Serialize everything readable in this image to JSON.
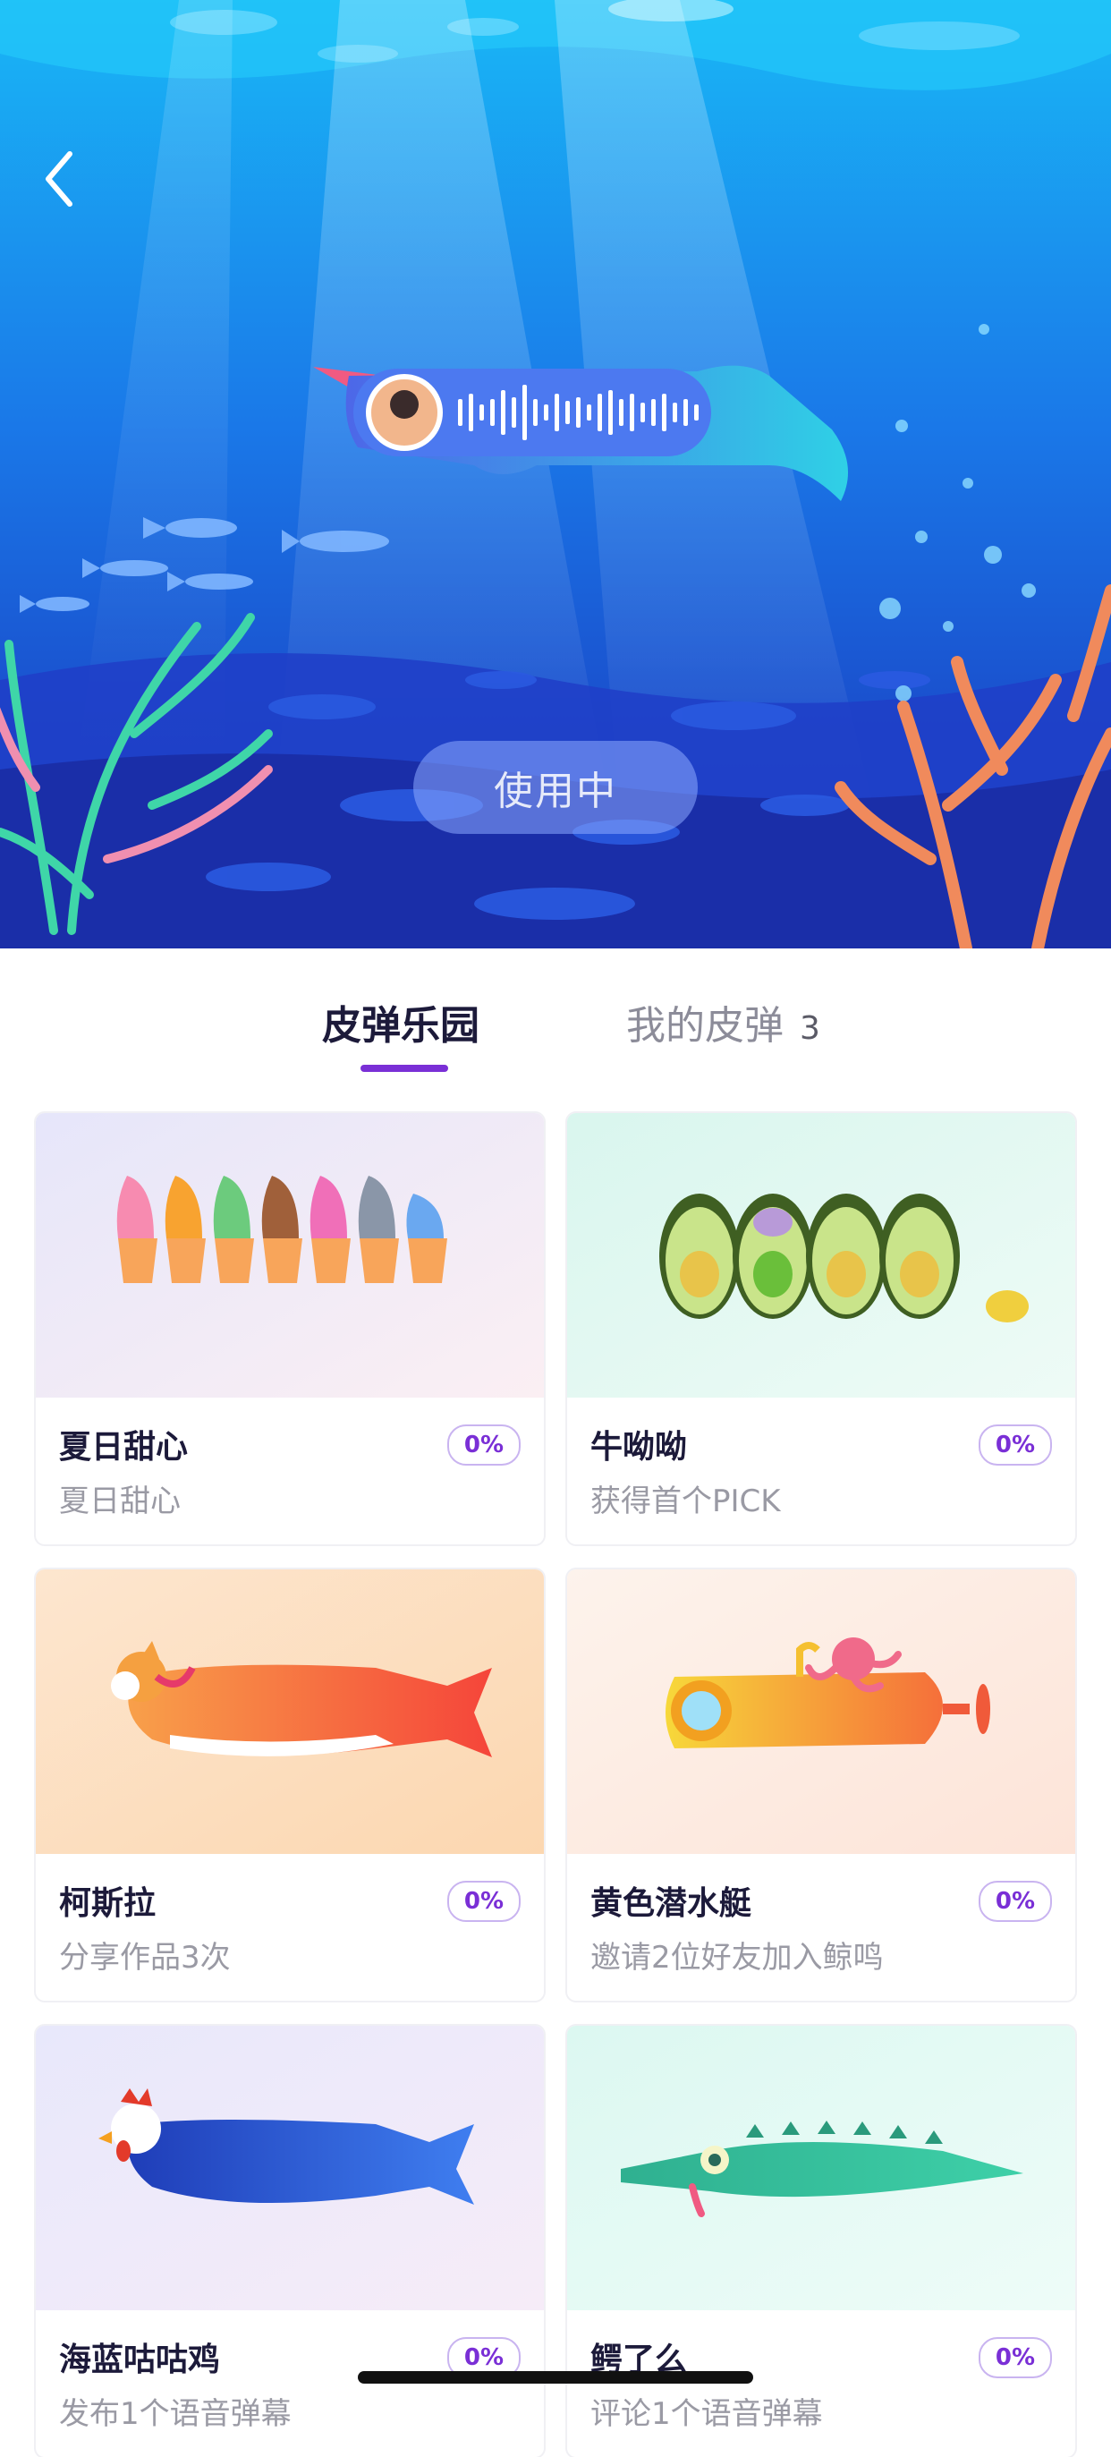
{
  "hero": {
    "use_button_label": "使用中"
  },
  "tabs": [
    {
      "label": "皮弹乐园",
      "active": true
    },
    {
      "label": "我的皮弹",
      "count": "3",
      "active": false
    }
  ],
  "cards": [
    {
      "name": "夏日甜心",
      "desc": "夏日甜心",
      "progress": "0%",
      "theme": "ice-cream"
    },
    {
      "name": "牛呦呦",
      "desc": "获得首个PICK",
      "progress": "0%",
      "theme": "avocado"
    },
    {
      "name": "柯斯拉",
      "desc": "分享作品3次",
      "progress": "0%",
      "theme": "corgi-fish"
    },
    {
      "name": "黄色潜水艇",
      "desc": "邀请2位好友加入鲸鸣",
      "progress": "0%",
      "theme": "submarine"
    },
    {
      "name": "海蓝咕咕鸡",
      "desc": "发布1个语音弹幕",
      "progress": "0%",
      "theme": "rooster-fish"
    },
    {
      "name": "鳄了么",
      "desc": "评论1个语音弹幕",
      "progress": "0%",
      "theme": "crocodile"
    }
  ],
  "colors": {
    "accent": "#7a2fd6",
    "ocean_top": "#1aa0f0",
    "ocean_bottom": "#1f33c8"
  }
}
